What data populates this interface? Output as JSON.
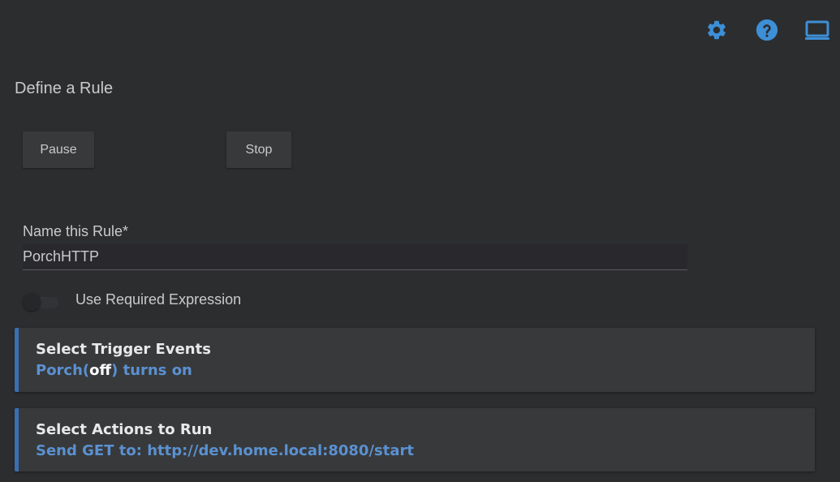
{
  "header": {
    "icons": [
      "gear-icon",
      "help-icon",
      "laptop-icon"
    ],
    "accent_color": "#3d8fd6"
  },
  "page_title": "Define a Rule",
  "buttons": {
    "pause_label": "Pause",
    "stop_label": "Stop"
  },
  "name_field": {
    "label": "Name this Rule*",
    "value": "PorchHTTP"
  },
  "required_expression": {
    "label": "Use Required Expression",
    "enabled": false
  },
  "trigger_card": {
    "title": "Select Trigger Events",
    "device": "Porch(",
    "state": "off",
    "suffix": ") turns on"
  },
  "actions_card": {
    "title": "Select Actions to Run",
    "action": "Send GET to: http://dev.home.local:8080/start"
  }
}
